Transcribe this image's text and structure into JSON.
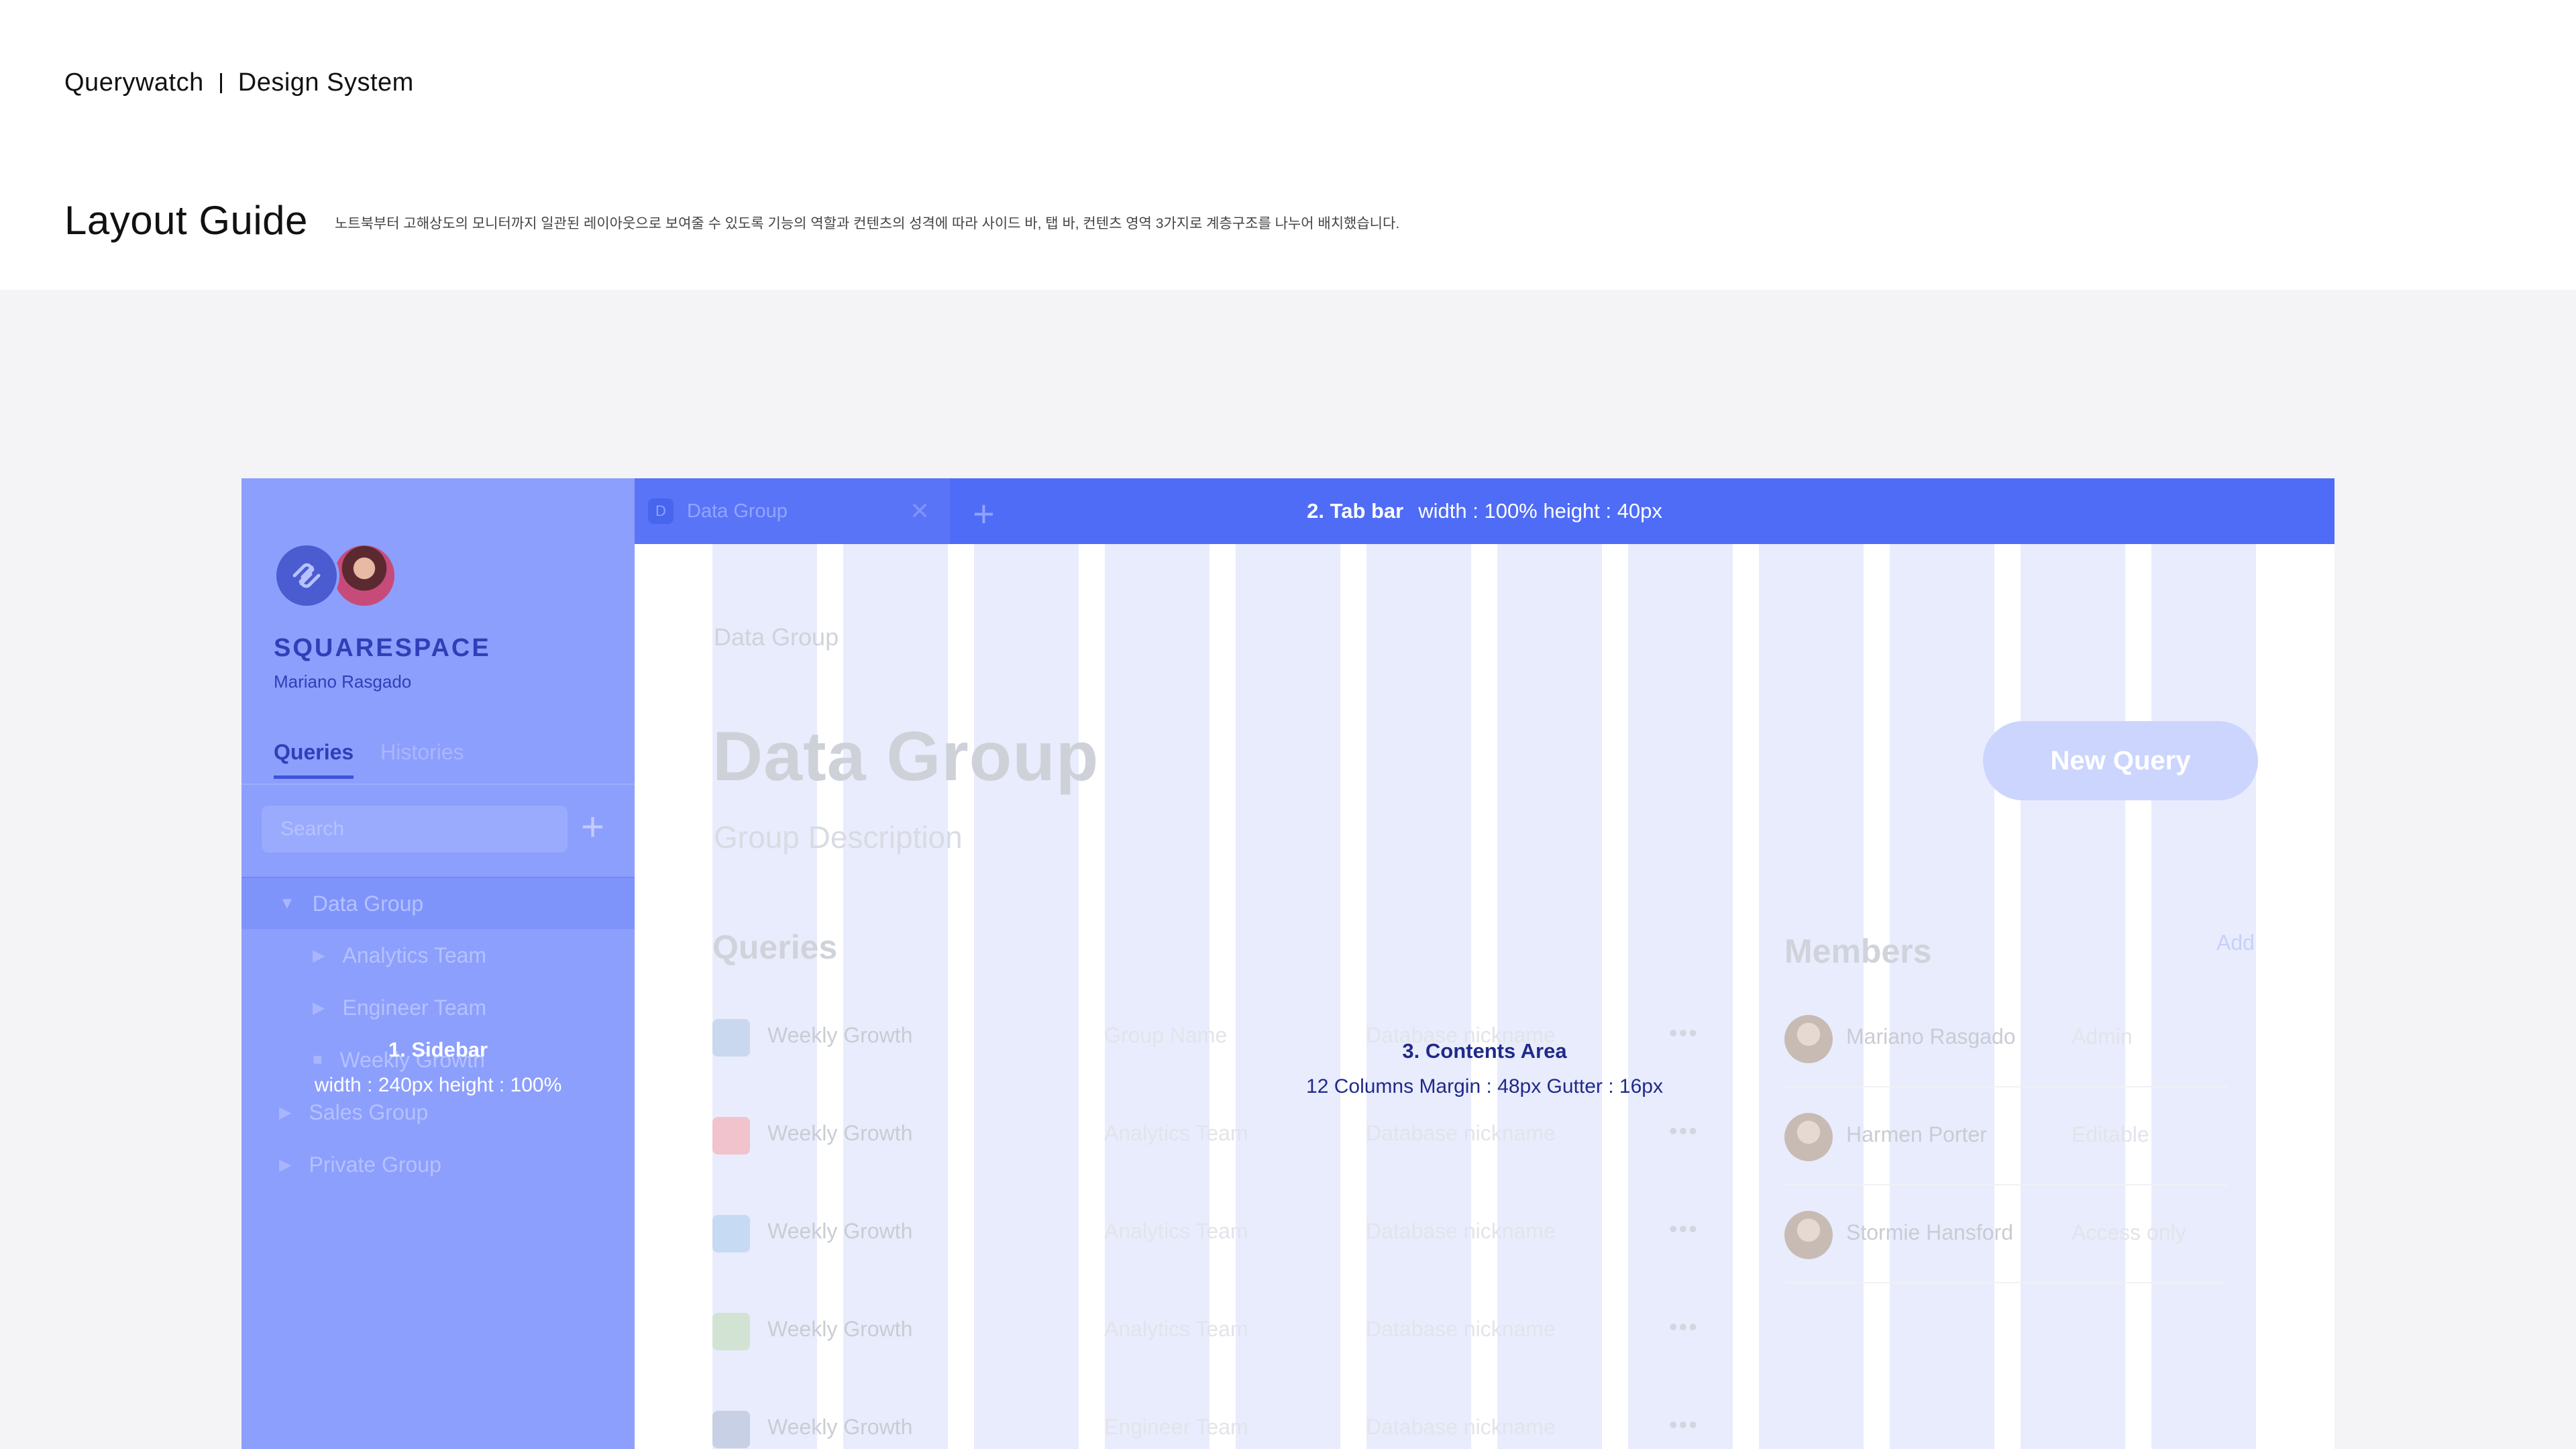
{
  "header": {
    "brand": "Querywatch",
    "section": "Design System",
    "page_title": "Layout Guide",
    "description": "노트북부터 고해상도의 모니터까지 일관된 레이아웃으로 보여줄 수 있도록 기능의 역할과 컨텐츠의 성격에 따라 사이드 바, 탭 바, 컨텐츠 영역 3가지로 계층구조를 나누어 배치했습니다."
  },
  "sidebar": {
    "org_name": "SQUARESPACE",
    "user_name": "Mariano Rasgado",
    "tabs": [
      "Queries",
      "Histories"
    ],
    "search_placeholder": "Search",
    "add_symbol": "+",
    "tree": [
      {
        "label": "Data Group",
        "arrow": "▼",
        "level": 0,
        "selected": true
      },
      {
        "label": "Analytics Team",
        "arrow": "▶",
        "level": 1
      },
      {
        "label": "Engineer Team",
        "arrow": "▶",
        "level": 1
      },
      {
        "label": "Weekly Growth",
        "arrow": "■",
        "level": 1
      },
      {
        "label": "Sales Group",
        "arrow": "▶",
        "level": 0
      },
      {
        "label": "Private Group",
        "arrow": "▶",
        "level": 0
      }
    ],
    "note": {
      "title": "1. Sidebar",
      "spec": "width : 240px  height : 100%"
    }
  },
  "tabbar": {
    "tab_icon": "D",
    "tab_label": "Data Group",
    "close_symbol": "✕",
    "add_symbol": "+",
    "note": {
      "title": "2. Tab bar",
      "spec": "width : 100%  height : 40px"
    }
  },
  "content": {
    "breadcrumb": "Data Group",
    "title": "Data Group",
    "description": "Group Description",
    "new_query_label": "New Query",
    "queries_heading": "Queries",
    "members_heading": "Members",
    "add_label": "Add",
    "queries": [
      {
        "name": "Weekly Growth",
        "team": "Group Name",
        "db": "Database nickname",
        "icon_color": "#c9d8ef"
      },
      {
        "name": "Weekly Growth",
        "team": "Analytics Team",
        "db": "Database nickname",
        "icon_color": "#f1c3cc"
      },
      {
        "name": "Weekly Growth",
        "team": "Analytics Team",
        "db": "Database nickname",
        "icon_color": "#c7daf3"
      },
      {
        "name": "Weekly Growth",
        "team": "Analytics Team",
        "db": "Database nickname",
        "icon_color": "#d3e3d3"
      },
      {
        "name": "Weekly Growth",
        "team": "Engineer Team",
        "db": "Database nickname",
        "icon_color": "#c8d0e6"
      }
    ],
    "more_symbol": "•••",
    "members": [
      {
        "name": "Mariano Rasgado",
        "role": "Admin"
      },
      {
        "name": "Harmen Porter",
        "role": "Editable"
      },
      {
        "name": "Stormie Hansford",
        "role": "Access only"
      }
    ],
    "note": {
      "title": "3. Contents Area",
      "spec": "12 Columns  Margin : 48px  Gutter : 16px"
    }
  },
  "colors": {
    "sidebar": "#8c9ffc",
    "tabbar": "#4f6cf6",
    "grid_column": "#e9ecfd",
    "stage": "#f4f4f6"
  }
}
